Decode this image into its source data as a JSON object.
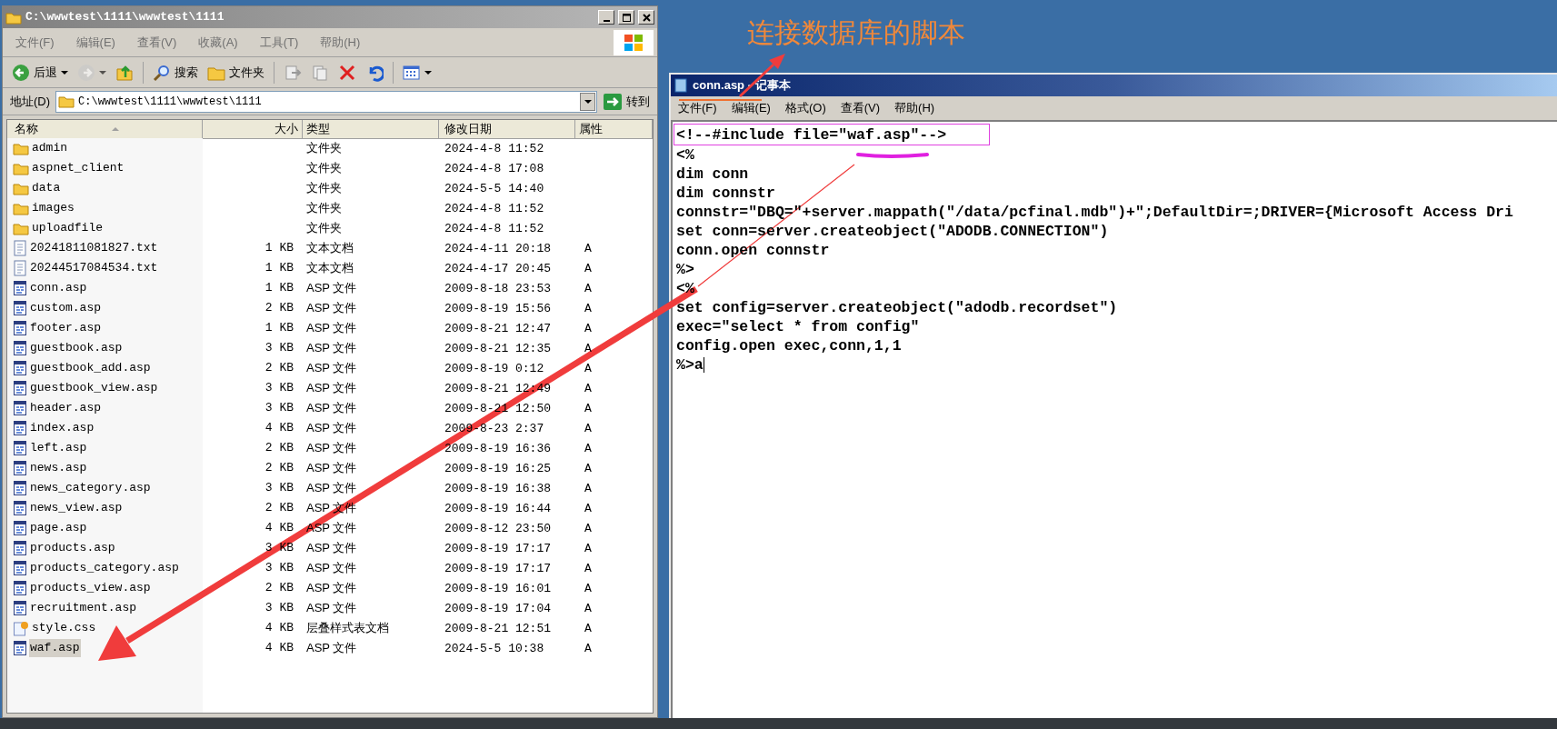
{
  "explorer": {
    "title": "C:\\wwwtest\\1111\\wwwtest\\1111",
    "menu": [
      "文件(F)",
      "编辑(E)",
      "查看(V)",
      "收藏(A)",
      "工具(T)",
      "帮助(H)"
    ],
    "toolbar": [
      {
        "kind": "back",
        "label": "后退",
        "disabled": false
      },
      {
        "kind": "forward",
        "disabled": true
      },
      {
        "kind": "up"
      },
      {
        "kind": "search",
        "label": "搜索"
      },
      {
        "kind": "folders",
        "label": "文件夹"
      },
      {
        "kind": "move"
      },
      {
        "kind": "copy"
      },
      {
        "kind": "delete"
      },
      {
        "kind": "undo"
      },
      {
        "kind": "views"
      }
    ],
    "address": {
      "label": "地址(D)",
      "value": "C:\\wwwtest\\1111\\wwwtest\\1111",
      "go": "转到"
    },
    "columns": [
      "名称",
      "大小",
      "类型",
      "修改日期",
      "属性"
    ],
    "files": [
      {
        "kind": "folder",
        "name": "admin",
        "type": "文件夹",
        "modified": "2024-4-8 11:52",
        "selected": false
      },
      {
        "kind": "folder",
        "name": "aspnet_client",
        "type": "文件夹",
        "modified": "2024-4-8 17:08",
        "selected": false
      },
      {
        "kind": "folder",
        "name": "data",
        "type": "文件夹",
        "modified": "2024-5-5 14:40",
        "selected": false
      },
      {
        "kind": "folder",
        "name": "images",
        "type": "文件夹",
        "modified": "2024-4-8 11:52",
        "selected": false
      },
      {
        "kind": "folder",
        "name": "uploadfile",
        "type": "文件夹",
        "modified": "2024-4-8 11:52",
        "selected": false
      },
      {
        "kind": "txt",
        "name": "20241811081827.txt",
        "size": "1 KB",
        "type": "文本文档",
        "modified": "2024-4-11 20:18",
        "attributes": "A",
        "selected": false
      },
      {
        "kind": "txt",
        "name": "20244517084534.txt",
        "size": "1 KB",
        "type": "文本文档",
        "modified": "2024-4-17 20:45",
        "attributes": "A",
        "selected": false
      },
      {
        "kind": "asp",
        "name": "conn.asp",
        "size": "1 KB",
        "type": "ASP 文件",
        "modified": "2009-8-18 23:53",
        "attributes": "A",
        "selected": false
      },
      {
        "kind": "asp",
        "name": "custom.asp",
        "size": "2 KB",
        "type": "ASP 文件",
        "modified": "2009-8-19 15:56",
        "attributes": "A",
        "selected": false
      },
      {
        "kind": "asp",
        "name": "footer.asp",
        "size": "1 KB",
        "type": "ASP 文件",
        "modified": "2009-8-21 12:47",
        "attributes": "A",
        "selected": false
      },
      {
        "kind": "asp",
        "name": "guestbook.asp",
        "size": "3 KB",
        "type": "ASP 文件",
        "modified": "2009-8-21 12:35",
        "attributes": "A",
        "selected": false
      },
      {
        "kind": "asp",
        "name": "guestbook_add.asp",
        "size": "2 KB",
        "type": "ASP 文件",
        "modified": "2009-8-19 0:12",
        "attributes": "A",
        "selected": false
      },
      {
        "kind": "asp",
        "name": "guestbook_view.asp",
        "size": "3 KB",
        "type": "ASP 文件",
        "modified": "2009-8-21 12:49",
        "attributes": "A",
        "selected": false
      },
      {
        "kind": "asp",
        "name": "header.asp",
        "size": "3 KB",
        "type": "ASP 文件",
        "modified": "2009-8-21 12:50",
        "attributes": "A",
        "selected": false
      },
      {
        "kind": "asp",
        "name": "index.asp",
        "size": "4 KB",
        "type": "ASP 文件",
        "modified": "2009-8-23 2:37",
        "attributes": "A",
        "selected": false
      },
      {
        "kind": "asp",
        "name": "left.asp",
        "size": "2 KB",
        "type": "ASP 文件",
        "modified": "2009-8-19 16:36",
        "attributes": "A",
        "selected": false
      },
      {
        "kind": "asp",
        "name": "news.asp",
        "size": "2 KB",
        "type": "ASP 文件",
        "modified": "2009-8-19 16:25",
        "attributes": "A",
        "selected": false
      },
      {
        "kind": "asp",
        "name": "news_category.asp",
        "size": "3 KB",
        "type": "ASP 文件",
        "modified": "2009-8-19 16:38",
        "attributes": "A",
        "selected": false
      },
      {
        "kind": "asp",
        "name": "news_view.asp",
        "size": "2 KB",
        "type": "ASP 文件",
        "modified": "2009-8-19 16:44",
        "attributes": "A",
        "selected": false
      },
      {
        "kind": "asp",
        "name": "page.asp",
        "size": "4 KB",
        "type": "ASP 文件",
        "modified": "2009-8-12 23:50",
        "attributes": "A",
        "selected": false
      },
      {
        "kind": "asp",
        "name": "products.asp",
        "size": "3 KB",
        "type": "ASP 文件",
        "modified": "2009-8-19 17:17",
        "attributes": "A",
        "selected": false
      },
      {
        "kind": "asp",
        "name": "products_category.asp",
        "size": "3 KB",
        "type": "ASP 文件",
        "modified": "2009-8-19 17:17",
        "attributes": "A",
        "selected": false
      },
      {
        "kind": "asp",
        "name": "products_view.asp",
        "size": "2 KB",
        "type": "ASP 文件",
        "modified": "2009-8-19 16:01",
        "attributes": "A",
        "selected": false
      },
      {
        "kind": "asp",
        "name": "recruitment.asp",
        "size": "3 KB",
        "type": "ASP 文件",
        "modified": "2009-8-19 17:04",
        "attributes": "A",
        "selected": false
      },
      {
        "kind": "css",
        "name": "style.css",
        "size": "4 KB",
        "type": "层叠样式表文档",
        "modified": "2009-8-21 12:51",
        "attributes": "A",
        "selected": false
      },
      {
        "kind": "asp",
        "name": "waf.asp",
        "size": "4 KB",
        "type": "ASP 文件",
        "modified": "2024-5-5 10:38",
        "attributes": "A",
        "selected": true
      }
    ]
  },
  "annotation": {
    "text": "连接数据库的脚本"
  },
  "notepad": {
    "title": "conn.asp - 记事本",
    "menu": [
      "文件(F)",
      "编辑(E)",
      "格式(O)",
      "查看(V)",
      "帮助(H)"
    ],
    "lines": [
      "<!--#include file=\"waf.asp\"-->",
      "<%",
      "dim conn",
      "dim connstr",
      "connstr=\"DBQ=\"+server.mappath(\"/data/pcfinal.mdb\")+\";DefaultDir=;DRIVER={Microsoft Access Dri",
      "set conn=server.createobject(\"ADODB.CONNECTION\")",
      "conn.open connstr",
      "%>",
      "<%",
      "set config=server.createobject(\"adodb.recordset\")",
      "exec=\"select * from config\"",
      "config.open exec,conn,1,1",
      "%>a"
    ]
  }
}
